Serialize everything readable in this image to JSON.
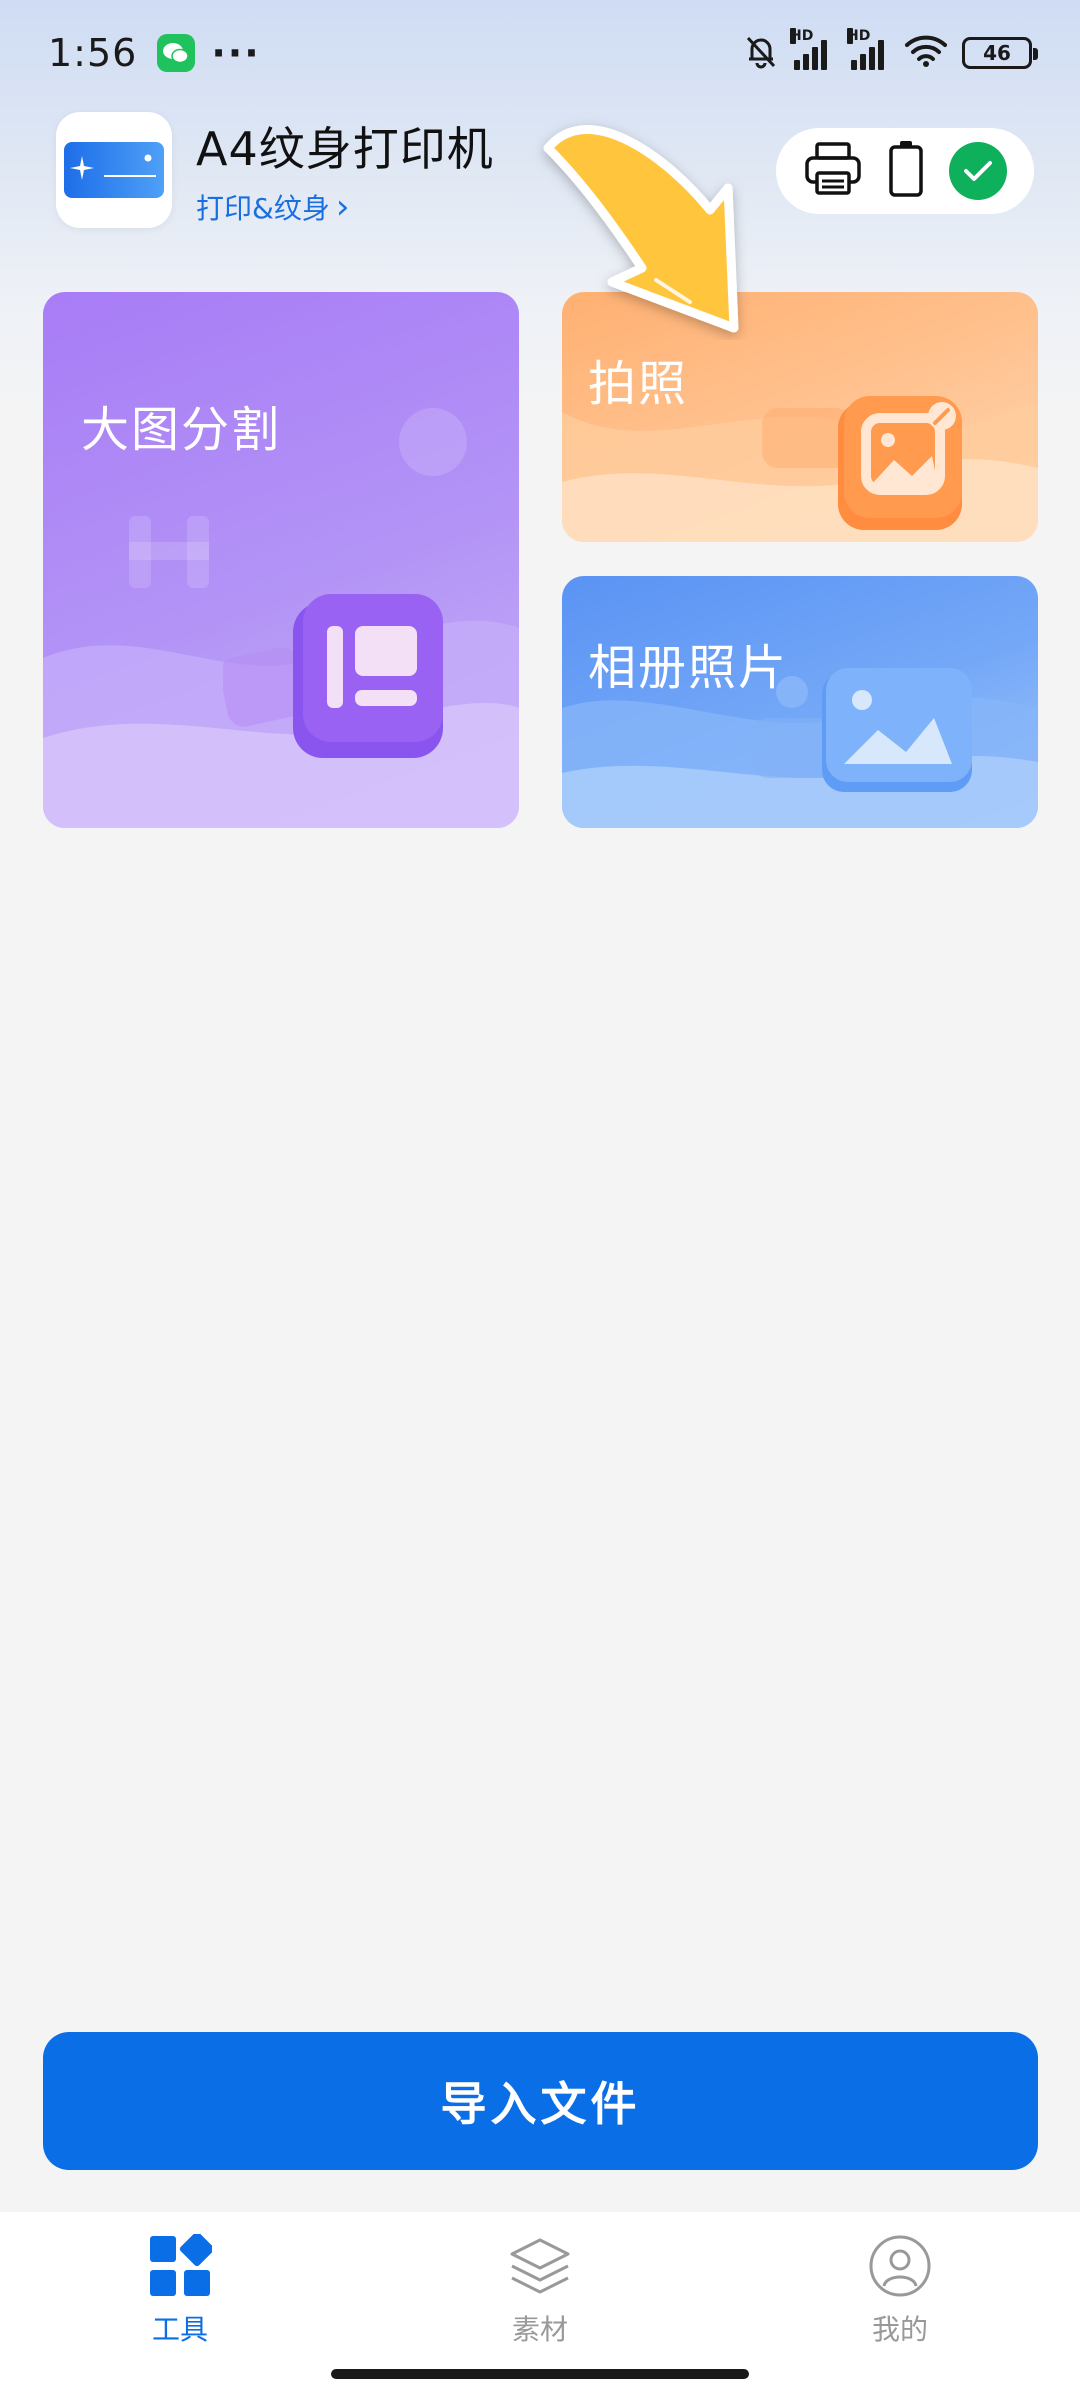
{
  "status_bar": {
    "time": "1:56",
    "dots": "···",
    "hd_label": "HD",
    "battery_level": "46"
  },
  "app": {
    "title": "A4纹身打印机",
    "subtitle": "打印&纹身",
    "subtitle_chevron": "›"
  },
  "device_status": {
    "printer_icon": "printer-icon",
    "battery_icon": "battery-outline-icon",
    "connected_icon": "check-circle-icon",
    "accent": "#0fb05c"
  },
  "cards": {
    "split": {
      "label": "大图分割",
      "icon": "layout-panel-icon"
    },
    "photo": {
      "label": "拍照",
      "icon": "camera-photo-icon"
    },
    "album": {
      "label": "相册照片",
      "icon": "image-gallery-icon"
    }
  },
  "import_button": {
    "label": "导入文件"
  },
  "bottom_nav": {
    "items": [
      {
        "label": "工具",
        "icon": "grid-tools-icon",
        "active": true
      },
      {
        "label": "素材",
        "icon": "layers-icon",
        "active": false
      },
      {
        "label": "我的",
        "icon": "profile-icon",
        "active": false
      }
    ]
  },
  "colors": {
    "primary": "#0a6fe6",
    "split_card": "#a87cf6",
    "photo_card": "#ffb071",
    "album_card": "#5a93f4",
    "arrow": "#ffc53d"
  }
}
